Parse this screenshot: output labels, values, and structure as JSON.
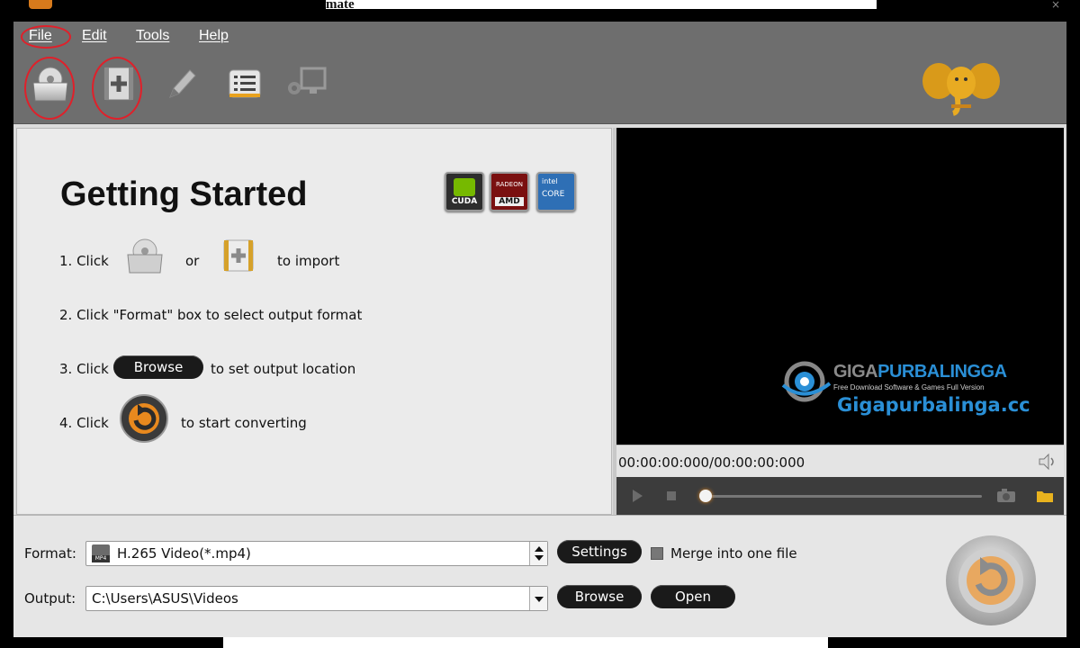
{
  "window": {
    "title_fragment": "mate"
  },
  "menu": {
    "items": [
      {
        "label": "File",
        "name": "menu-file"
      },
      {
        "label": "Edit",
        "name": "menu-edit"
      },
      {
        "label": "Tools",
        "name": "menu-tools"
      },
      {
        "label": "Help",
        "name": "menu-help"
      }
    ]
  },
  "toolbar": {
    "icons": [
      "add-dvd-icon",
      "add-video-icon",
      "edit-icon",
      "task-list-icon",
      "device-icon"
    ],
    "logo": "dumbo-elephant-logo"
  },
  "getting_started": {
    "title": "Getting Started",
    "step1_prefix": "1. Click",
    "step1_or": "or",
    "step1_suffix": "to import",
    "step2": "2. Click \"Format\" box to select output format",
    "step3_prefix": "3. Click",
    "step3_button": "Browse",
    "step3_suffix": "to set output location",
    "step4_prefix": "4. Click",
    "step4_suffix": "to start converting",
    "badges": [
      {
        "name": "nvidia-cuda-badge",
        "label": "CUDA"
      },
      {
        "name": "amd-radeon-badge",
        "label": "AMD",
        "sub": "RADEON"
      },
      {
        "name": "intel-core-badge",
        "label": "CORE",
        "sub": "intel"
      }
    ]
  },
  "preview": {
    "watermark_title_1": "GIGA",
    "watermark_title_2": "PURBALINGGA",
    "watermark_sub": "Free Download Software & Games Full Version",
    "watermark_url": "Gigapurbalinga.cc",
    "timecode": "00:00:00:000/00:00:00:000"
  },
  "bottom": {
    "format_label": "Format:",
    "format_value": "H.265 Video(*.mp4)",
    "format_badge": "MP4",
    "settings_button": "Settings",
    "merge_label": "Merge into one file",
    "merge_checked": false,
    "output_label": "Output:",
    "output_value": "C:\\Users\\ASUS\\Videos",
    "browse_button": "Browse",
    "open_button": "Open"
  },
  "colors": {
    "accent_orange": "#e8891e",
    "toolbar_gray": "#6e6e6e",
    "highlight_red": "#e0202a",
    "watermark_blue": "#2a8fd6"
  }
}
